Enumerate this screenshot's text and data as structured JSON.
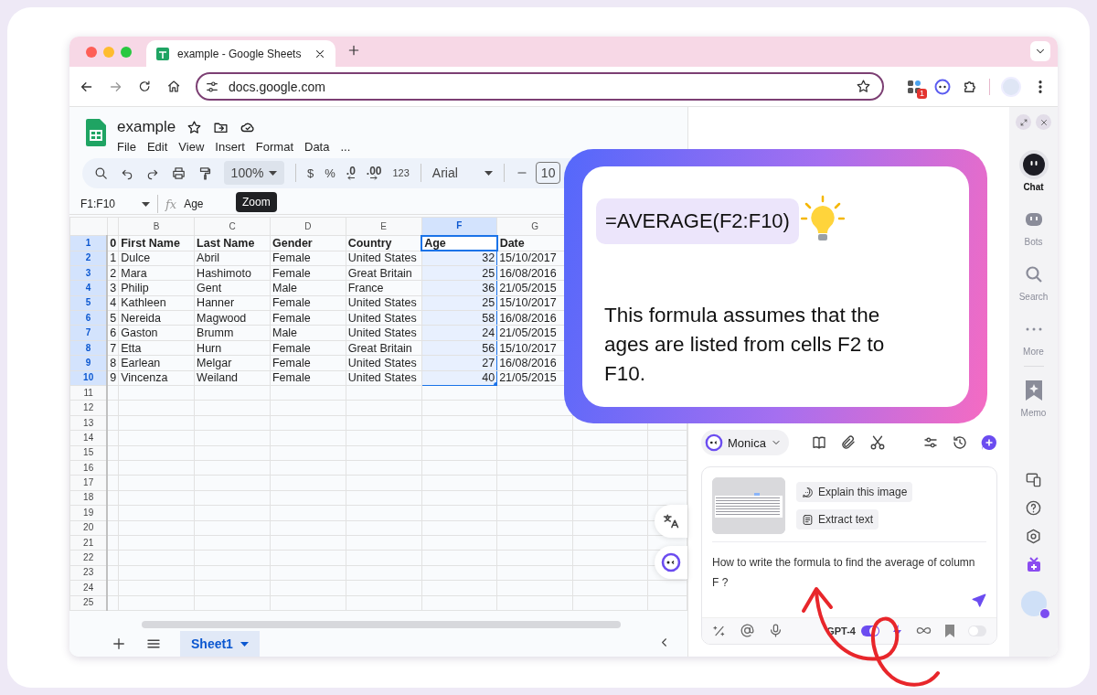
{
  "browser": {
    "tabs": [
      {
        "title": "example - Google Sheets",
        "selected": true
      }
    ],
    "url": "docs.google.com",
    "extension_badge": "1"
  },
  "sheets": {
    "doc_title": "example",
    "menu": [
      "File",
      "Edit",
      "View",
      "Insert",
      "Format",
      "Data",
      "..."
    ],
    "toolbar": {
      "zoom": "100%",
      "currency": "$",
      "percent": "%",
      "decrease_decimals": ".0",
      "increase_decimals": ".00",
      "number_format": "123",
      "font": "Arial",
      "font_size": "10"
    },
    "tooltip": "Zoom",
    "name_box": "F1:F10",
    "fx_label": "fx",
    "formula": "Age",
    "columns": [
      {
        "label": "B",
        "selected": false
      },
      {
        "label": "C",
        "selected": false
      },
      {
        "label": "D",
        "selected": false
      },
      {
        "label": "E",
        "selected": false
      },
      {
        "label": "F",
        "selected": true
      },
      {
        "label": "G",
        "selected": false
      }
    ],
    "rows": [
      {
        "number": "1",
        "selected": true,
        "kind": "header",
        "cells": [
          "0",
          "First Name",
          "Last Name",
          "Gender",
          "Country",
          "Age",
          "Date"
        ]
      },
      {
        "number": "2",
        "selected": true,
        "kind": "data",
        "cells": [
          "1",
          "Dulce",
          "Abril",
          "Female",
          "United States",
          {
            "text": "32",
            "kind": "number"
          },
          "15/10/2017"
        ]
      },
      {
        "number": "3",
        "selected": true,
        "kind": "data",
        "cells": [
          "2",
          "Mara",
          "Hashimoto",
          "Female",
          "Great Britain",
          {
            "text": "25",
            "kind": "number"
          },
          "16/08/2016"
        ]
      },
      {
        "number": "4",
        "selected": true,
        "kind": "data",
        "cells": [
          "3",
          "Philip",
          "Gent",
          "Male",
          "France",
          {
            "text": "36",
            "kind": "number"
          },
          "21/05/2015"
        ]
      },
      {
        "number": "5",
        "selected": true,
        "kind": "data",
        "cells": [
          "4",
          "Kathleen",
          "Hanner",
          "Female",
          "United States",
          {
            "text": "25",
            "kind": "number"
          },
          "15/10/2017"
        ]
      },
      {
        "number": "6",
        "selected": true,
        "kind": "data",
        "cells": [
          "5",
          "Nereida",
          "Magwood",
          "Female",
          "United States",
          {
            "text": "58",
            "kind": "number"
          },
          "16/08/2016"
        ]
      },
      {
        "number": "7",
        "selected": true,
        "kind": "data",
        "cells": [
          "6",
          "Gaston",
          "Brumm",
          "Male",
          "United States",
          {
            "text": "24",
            "kind": "number"
          },
          "21/05/2015"
        ]
      },
      {
        "number": "8",
        "selected": true,
        "kind": "data",
        "cells": [
          "7",
          "Etta",
          "Hurn",
          "Female",
          "Great Britain",
          {
            "text": "56",
            "kind": "number"
          },
          "15/10/2017"
        ]
      },
      {
        "number": "9",
        "selected": true,
        "kind": "data",
        "cells": [
          "8",
          "Earlean",
          "Melgar",
          "Female",
          "United States",
          {
            "text": "27",
            "kind": "number"
          },
          "16/08/2016"
        ]
      },
      {
        "number": "10",
        "selected": true,
        "kind": "data",
        "cells": [
          "9",
          "Vincenza",
          "Weiland",
          "Female",
          "United States",
          {
            "text": "40",
            "kind": "number"
          },
          "21/05/2015"
        ]
      },
      {
        "number": "11",
        "selected": false
      },
      {
        "number": "12",
        "selected": false
      },
      {
        "number": "13",
        "selected": false
      },
      {
        "number": "14",
        "selected": false
      },
      {
        "number": "15",
        "selected": false
      },
      {
        "number": "16",
        "selected": false
      },
      {
        "number": "17",
        "selected": false
      },
      {
        "number": "18",
        "selected": false
      },
      {
        "number": "19",
        "selected": false
      },
      {
        "number": "20",
        "selected": false
      },
      {
        "number": "21",
        "selected": false
      },
      {
        "number": "22",
        "selected": false
      },
      {
        "number": "23",
        "selected": false
      },
      {
        "number": "24",
        "selected": false
      },
      {
        "number": "25",
        "selected": false
      }
    ],
    "sheet_tabs": [
      {
        "label": "Sheet1",
        "selected": true
      }
    ]
  },
  "monica": {
    "assistant": "Monica",
    "actions": [
      "Explain this image",
      "Extract text"
    ],
    "message": "How to write the formula to find the average of column F ?",
    "model": "GPT-4",
    "toggles": [
      {
        "on": true
      },
      {
        "on": false
      }
    ]
  },
  "rail": {
    "items": [
      {
        "label": "Chat",
        "selected": true
      },
      {
        "label": "Bots",
        "selected": false
      },
      {
        "label": "Search",
        "selected": false
      },
      {
        "label": "More",
        "selected": false
      },
      {
        "label": "Memo",
        "selected": false
      }
    ]
  },
  "callout": {
    "formula": "=AVERAGE(F2:F10)",
    "text": "This formula assumes that the ages are listed from cells F2 to F10."
  }
}
